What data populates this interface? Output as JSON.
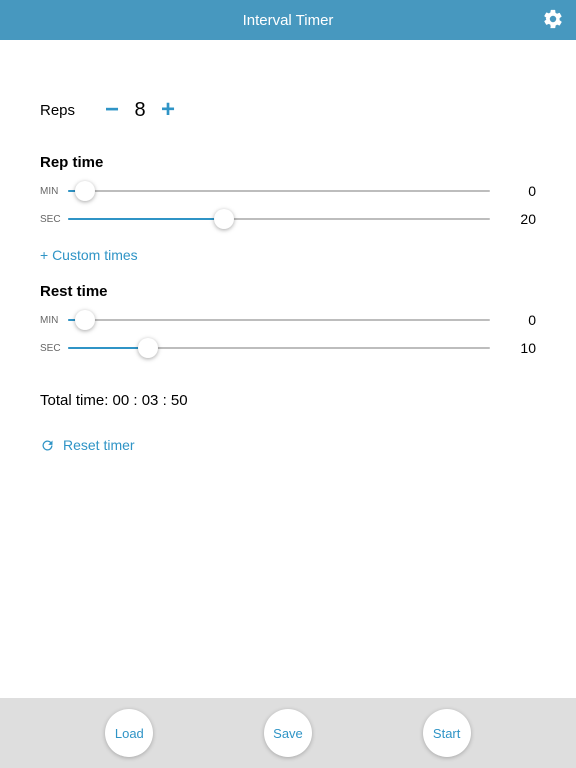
{
  "header": {
    "title": "Interval Timer"
  },
  "reps": {
    "label": "Reps",
    "value": "8"
  },
  "rep_time": {
    "title": "Rep time",
    "min": {
      "label": "MIN",
      "value": "0",
      "pct": 4
    },
    "sec": {
      "label": "SEC",
      "value": "20",
      "pct": 37
    }
  },
  "custom_times": "+ Custom times",
  "rest_time": {
    "title": "Rest time",
    "min": {
      "label": "MIN",
      "value": "0",
      "pct": 4
    },
    "sec": {
      "label": "SEC",
      "value": "10",
      "pct": 19
    }
  },
  "total": {
    "label": "Total time:",
    "value": "00 : 03 : 50"
  },
  "reset": "Reset timer",
  "footer": {
    "load": "Load",
    "save": "Save",
    "start": "Start"
  }
}
